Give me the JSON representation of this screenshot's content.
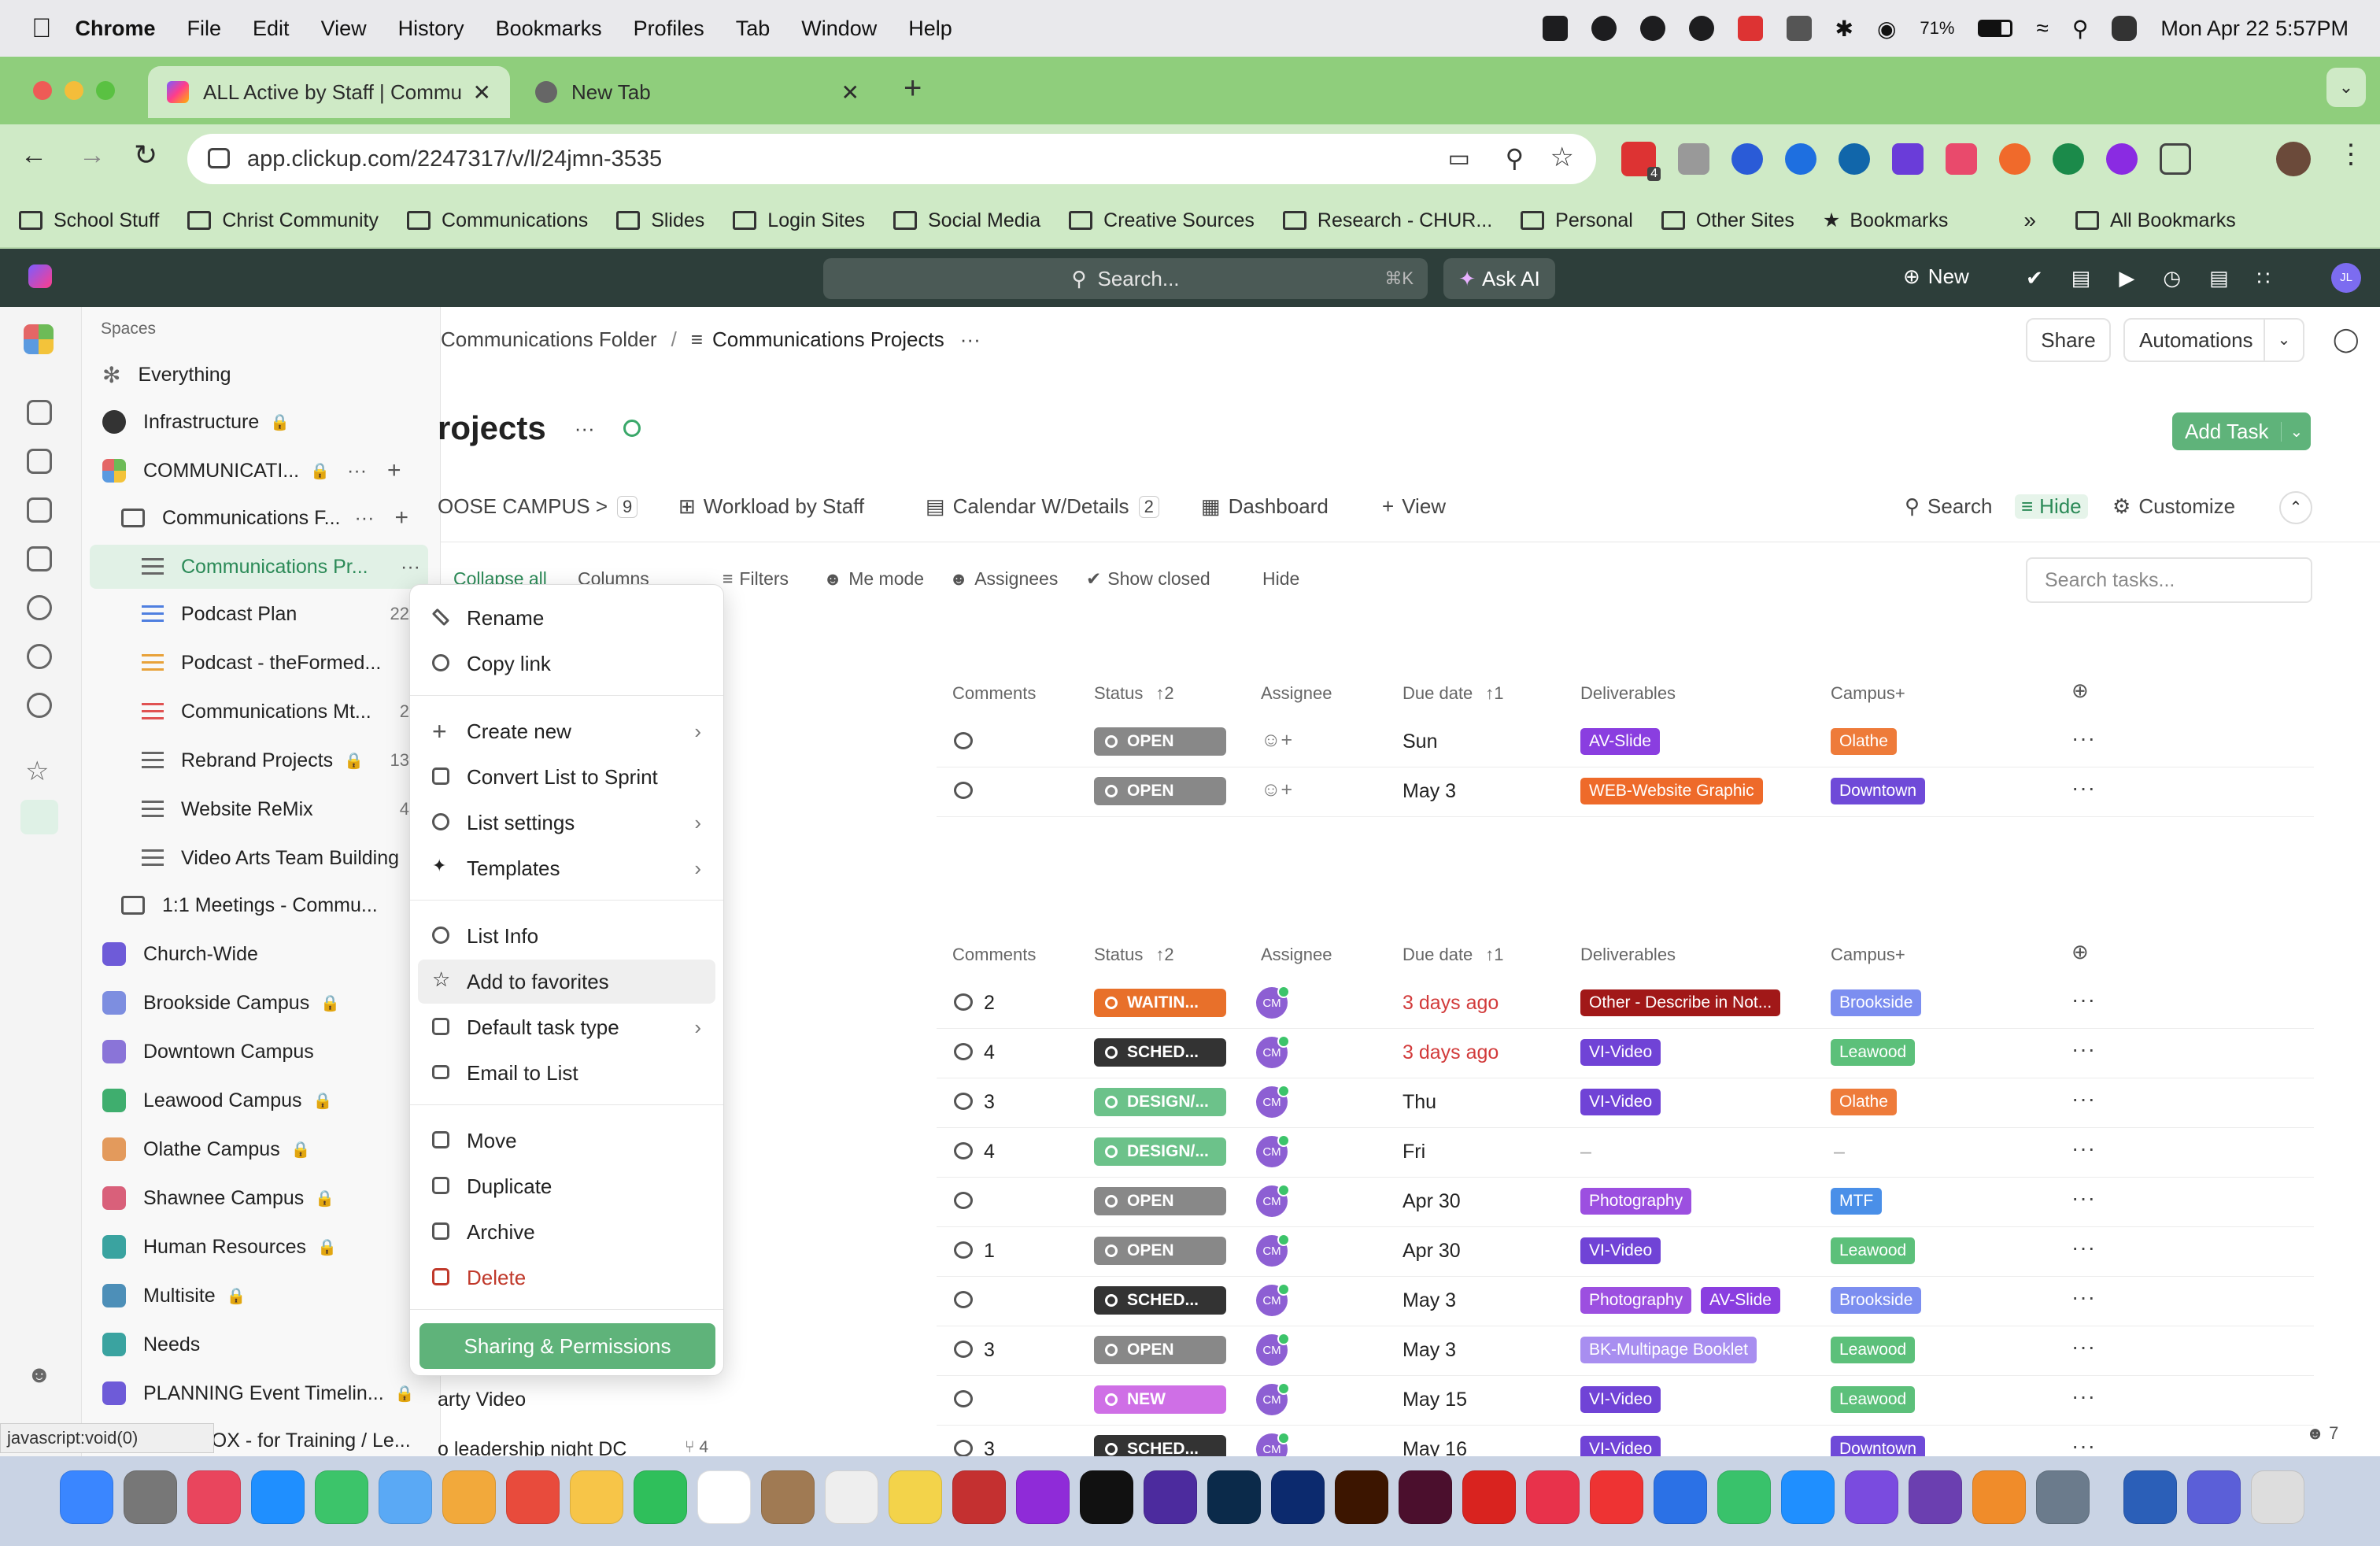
{
  "macbar": {
    "app": "Chrome",
    "menus": [
      "File",
      "Edit",
      "View",
      "History",
      "Bookmarks",
      "Profiles",
      "Tab",
      "Window",
      "Help"
    ],
    "battery": "71%",
    "datetime": "Mon Apr 22  5:57PM"
  },
  "chrome": {
    "tabs": [
      {
        "title": "ALL Active by Staff | Commu"
      },
      {
        "title": "New Tab"
      }
    ],
    "url": "app.clickup.com/2247317/v/l/24jmn-3535",
    "extension_badge": "4",
    "bookmarks": [
      "School Stuff",
      "Christ Community",
      "Communications",
      "Slides",
      "Login Sites",
      "Social Media",
      "Creative Sources",
      "Research - CHUR...",
      "Personal",
      "Other Sites",
      "Bookmarks"
    ],
    "all_bookmarks": "All Bookmarks"
  },
  "clickup_header": {
    "search_placeholder": "Search...",
    "search_shortcut": "⌘K",
    "ask_ai": "Ask AI",
    "new_label": "New",
    "avatar": "JL"
  },
  "sidebar": {
    "section": "Spaces",
    "items": [
      {
        "label": "Everything"
      },
      {
        "label": "Infrastructure"
      },
      {
        "label": "COMMUNICATI..."
      },
      {
        "label": "Communications F..."
      },
      {
        "label": "Communications Pr..."
      },
      {
        "label": "Podcast Plan",
        "count": "22"
      },
      {
        "label": "Podcast - theFormed..."
      },
      {
        "label": "Communications Mt...",
        "count": "2"
      },
      {
        "label": "Rebrand Projects",
        "count": "13"
      },
      {
        "label": "Website ReMix",
        "count": "4"
      },
      {
        "label": "Video Arts Team Building"
      },
      {
        "label": "1:1 Meetings - Commu..."
      },
      {
        "label": "Church-Wide"
      },
      {
        "label": "Brookside Campus"
      },
      {
        "label": "Downtown Campus"
      },
      {
        "label": "Leawood Campus"
      },
      {
        "label": "Olathe Campus"
      },
      {
        "label": "Shawnee Campus"
      },
      {
        "label": "Human Resources"
      },
      {
        "label": "Multisite"
      },
      {
        "label": "Needs"
      },
      {
        "label": "PLANNING Event Timelin..."
      },
      {
        "label": "NDBOX - for Training / Le..."
      }
    ],
    "status_url": "javascript:void(0)"
  },
  "breadcrumb": {
    "folder": "Communications Folder",
    "separator": "/",
    "list": "Communications Projects",
    "more": "···"
  },
  "header_buttons": {
    "share": "Share",
    "automations": "Automations"
  },
  "page": {
    "title": "rojects",
    "add_task": "Add Task"
  },
  "views": {
    "choose_campus": "OOSE CAMPUS >",
    "choose_campus_count": "9",
    "workload": "Workload by Staff",
    "calendar": "Calendar W/Details",
    "calendar_count": "2",
    "dashboard": "Dashboard",
    "add_view": "View",
    "search": "Search",
    "hide": "Hide",
    "customize": "Customize"
  },
  "filterbar": {
    "collapse": "Collapse all",
    "columns": "Columns",
    "filters": "Filters",
    "me_mode": "Me mode",
    "assignees": "Assignees",
    "show_closed": "Show closed",
    "hide": "Hide",
    "search_placeholder": "Search tasks..."
  },
  "columns": {
    "comments": "Comments",
    "status": "Status",
    "status_sort": "2",
    "assignee": "Assignee",
    "due": "Due date",
    "due_sort": "1",
    "deliverables": "Deliverables",
    "campus": "Campus+"
  },
  "group1": [
    {
      "comments": "",
      "status": "OPEN",
      "due": "Sun",
      "deliverables": [
        "AV-Slide"
      ],
      "campus": "Olathe"
    },
    {
      "comments": "",
      "status": "OPEN",
      "due": "May 3",
      "deliverables": [
        "WEB-Website Graphic"
      ],
      "campus": "Downtown"
    }
  ],
  "group2": [
    {
      "name": "",
      "comments": "2",
      "status": "WAITIN...",
      "due": "3 days ago",
      "deliverables": [
        "Other - Describe in Not..."
      ],
      "campus": "Brookside"
    },
    {
      "name": "",
      "comments": "4",
      "status": "SCHED...",
      "due": "3 days ago",
      "deliverables": [
        "VI-Video"
      ],
      "campus": "Leawood"
    },
    {
      "name": "",
      "comments": "3",
      "status": "DESIGN/...",
      "due": "Thu",
      "deliverables": [
        "VI-Video"
      ],
      "campus": "Olathe"
    },
    {
      "name": "",
      "comments": "4",
      "status": "DESIGN/...",
      "due": "Fri",
      "deliverables": [
        "–"
      ],
      "campus": "–"
    },
    {
      "name": "",
      "comments": "",
      "status": "OPEN",
      "due": "Apr 30",
      "deliverables": [
        "Photography"
      ],
      "campus": "MTF"
    },
    {
      "name": "",
      "comments": "1",
      "status": "OPEN",
      "due": "Apr 30",
      "deliverables": [
        "VI-Video"
      ],
      "campus": "Leawood"
    },
    {
      "name": "",
      "comments": "",
      "status": "SCHED...",
      "due": "May 3",
      "deliverables": [
        "Photography",
        "AV-Slide"
      ],
      "campus": "Brookside"
    },
    {
      "name": "",
      "comments": "3",
      "status": "OPEN",
      "due": "May 3",
      "deliverables": [
        "BK-Multipage Booklet"
      ],
      "campus": "Leawood"
    },
    {
      "name": "arty Video",
      "comments": "",
      "status": "NEW",
      "due": "May 15",
      "deliverables": [
        "VI-Video"
      ],
      "campus": "Leawood"
    },
    {
      "name": "o leadership night DC",
      "subtasks": "4",
      "comments": "3",
      "status": "SCHED...",
      "due": "May 16",
      "deliverables": [
        "VI-Video"
      ],
      "campus": "Downtown"
    }
  ],
  "avatar_initials": "CM",
  "context_menu": {
    "items": [
      "Rename",
      "Copy link",
      "Create new",
      "Convert List to Sprint",
      "List settings",
      "Templates",
      "List Info",
      "Add to favorites",
      "Default task type",
      "Email to List",
      "Move",
      "Duplicate",
      "Archive",
      "Delete"
    ],
    "share_button": "Sharing & Permissions"
  },
  "footer_count": "7",
  "colors": {
    "chrome_tab": "#8fce7c",
    "accent_green": "#5fb37a",
    "clickup_header": "#2d3e3a"
  }
}
